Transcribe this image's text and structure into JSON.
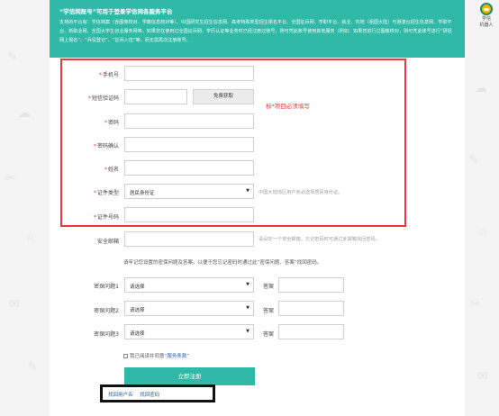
{
  "banner": {
    "title": "“学信网账号”可用于登录学信网各服务平台",
    "description": "支持的平台有：学信档案（含图像校对、学籍信息核对等）、中国研究生招生信息网、高考特殊类型招生报名平台、全国征兵网、学职平台、就业、内地（祖国大陆）与港澳台招生信息网、学职平台、新职业网、全国大学生创业服务网等。如果您在使用过全国征兵网、学历认证等业务时已经注册过账号，则可凭此账号使用其他服务（例如：如果您进行过图像校对，则可凭此账号进行“研招网上报名”、“兵役登记”、“征兵入伍”等，而无需再次注册账号。"
  },
  "form": {
    "phone_label": "手机号",
    "sms_label": "短信验证码",
    "sms_button": "免费获取",
    "password_label": "密码",
    "password_confirm_label": "密码确认",
    "name_label": "姓名",
    "id_type_label": "证件类型",
    "id_type_value": "居民身份证",
    "id_type_hint": "中国大陆地区用户务必选择居民身份证。",
    "id_number_label": "证件号码",
    "email_label": "安全邮箱",
    "email_hint": "请设定一个安全邮箱，忘记密码时可通过此邮箱找回密码。",
    "required_note": "标*项目必须填写",
    "required_mark": "*",
    "question_note": "请牢记您设置的密保问题及答案，以便于您忘记密码时通过此“密保问题、答案”找回密码。",
    "questions": [
      {
        "label": "密保问题1",
        "value": "请选择",
        "answer_label": "答案"
      },
      {
        "label": "密保问题2",
        "value": "请选择",
        "answer_label": "答案"
      },
      {
        "label": "密保问题3",
        "value": "请选择",
        "answer_label": "答案"
      }
    ],
    "agree_prefix": "我已阅读并同意",
    "agree_terms": "“服务条款”",
    "submit": "立即注册",
    "link_username": "找回用户名",
    "link_password": "找回密码",
    "select_arrow": "▼"
  },
  "robot": {
    "line1": "学信",
    "line2": "机器人"
  },
  "colors": {
    "accent": "#2fb9a6",
    "highlight_box": "#e63b3b",
    "required": "#e33333",
    "link": "#2a5ea8"
  }
}
